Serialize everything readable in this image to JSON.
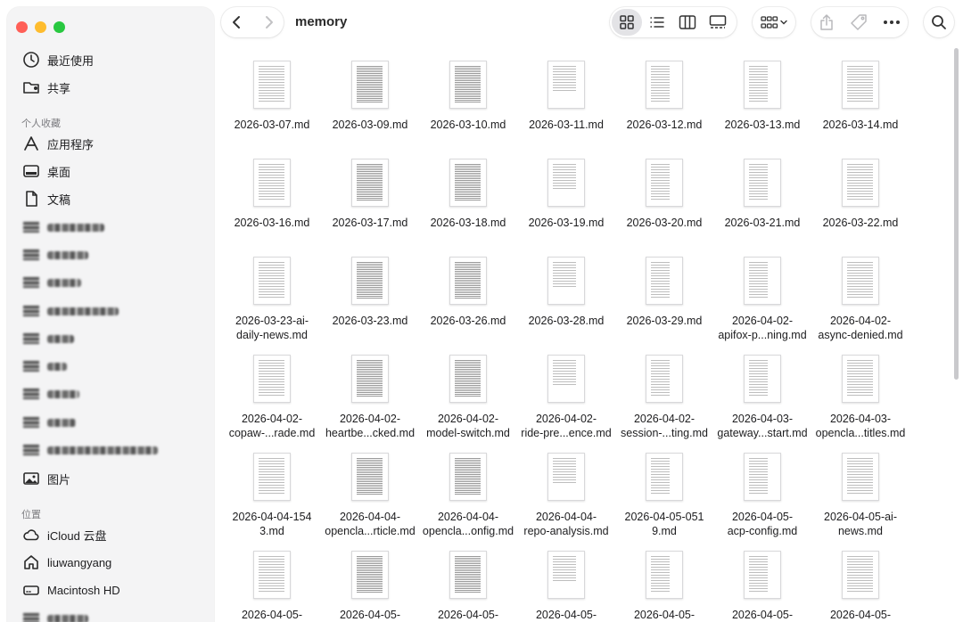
{
  "window": {
    "title": "memory"
  },
  "sidebar": {
    "recents": {
      "label": "最近使用",
      "icon": "clock-icon"
    },
    "shared": {
      "label": "共享",
      "icon": "shared-folder-icon"
    },
    "favorites_header": "个人收藏",
    "favorites": [
      {
        "label": "应用程序",
        "icon": "applications-icon"
      },
      {
        "label": "桌面",
        "icon": "desktop-icon"
      },
      {
        "label": "文稿",
        "icon": "document-icon"
      }
    ],
    "pictures": {
      "label": "图片",
      "icon": "photo-icon"
    },
    "locations_header": "位置",
    "locations": [
      {
        "label": "iCloud 云盘",
        "icon": "cloud-icon"
      },
      {
        "label": "liuwangyang",
        "icon": "home-icon"
      },
      {
        "label": "Macintosh HD",
        "icon": "disk-icon"
      }
    ]
  },
  "toolbar": {
    "back_icon": "chevron-left-icon",
    "forward_icon": "chevron-right-icon",
    "views": [
      "icon-view",
      "list-view",
      "column-view",
      "gallery-view"
    ],
    "active_view": "icon-view"
  },
  "files": [
    "2026-03-07.md",
    "2026-03-09.md",
    "2026-03-10.md",
    "2026-03-11.md",
    "2026-03-12.md",
    "2026-03-13.md",
    "2026-03-14.md",
    "2026-03-16.md",
    "2026-03-17.md",
    "2026-03-18.md",
    "2026-03-19.md",
    "2026-03-20.md",
    "2026-03-21.md",
    "2026-03-22.md",
    "2026-03-23-ai-\ndaily-news.md",
    "2026-03-23.md",
    "2026-03-26.md",
    "2026-03-28.md",
    "2026-03-29.md",
    "2026-04-02-\napifox-p...ning.md",
    "2026-04-02-\nasync-denied.md",
    "2026-04-02-\ncopaw-...rade.md",
    "2026-04-02-\nheartbe...cked.md",
    "2026-04-02-\nmodel-switch.md",
    "2026-04-02-\nride-pre...ence.md",
    "2026-04-02-\nsession-...ting.md",
    "2026-04-03-\ngateway...start.md",
    "2026-04-03-\nopencla...titles.md",
    "2026-04-04-154\n3.md",
    "2026-04-04-\nopencla...rticle.md",
    "2026-04-04-\nopencla...onfig.md",
    "2026-04-04-\nrepo-analysis.md",
    "2026-04-05-051\n9.md",
    "2026-04-05-\nacp-config.md",
    "2026-04-05-ai-\nnews.md",
    "2026-04-05-",
    "2026-04-05-",
    "2026-04-05-",
    "2026-04-05-",
    "2026-04-05-",
    "2026-04-05-",
    "2026-04-05-"
  ]
}
